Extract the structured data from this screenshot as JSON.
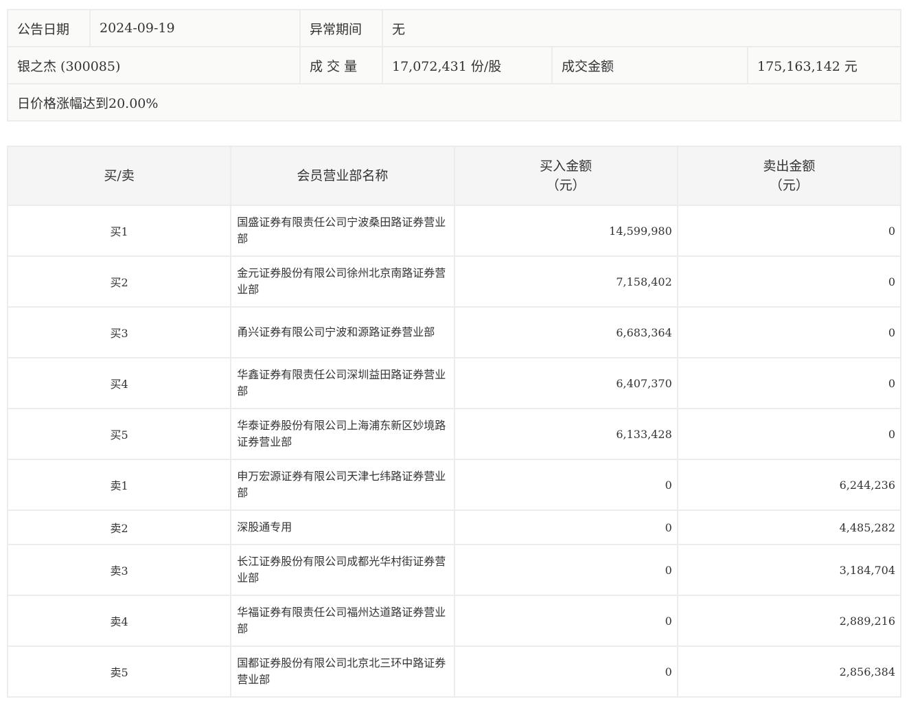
{
  "info": {
    "date_label": "公告日期",
    "date": "2024-09-19",
    "abnormal_label": "异常期间",
    "abnormal": "无",
    "stock": "银之杰 (300085)",
    "volume_label": "成 交 量",
    "volume": "17,072,431 份/股",
    "amount_label": "成交金额",
    "amount": "175,163,142 元",
    "reason": "日价格涨幅达到20.00%"
  },
  "table": {
    "headers": [
      "买/卖",
      "会员营业部名称",
      "买入金额",
      "卖出金额"
    ],
    "unit": "（元）",
    "rows": [
      {
        "side": "买1",
        "name": "国盛证券有限责任公司宁波桑田路证券营业部",
        "buy": "14,599,980",
        "sell": "0"
      },
      {
        "side": "买2",
        "name": "金元证券股份有限公司徐州北京南路证券营业部",
        "buy": "7,158,402",
        "sell": "0"
      },
      {
        "side": "买3",
        "name": "甬兴证券有限公司宁波和源路证券营业部",
        "buy": "6,683,364",
        "sell": "0"
      },
      {
        "side": "买4",
        "name": "华鑫证券有限责任公司深圳益田路证券营业部",
        "buy": "6,407,370",
        "sell": "0"
      },
      {
        "side": "买5",
        "name": "华泰证券股份有限公司上海浦东新区妙境路证券营业部",
        "buy": "6,133,428",
        "sell": "0"
      },
      {
        "side": "卖1",
        "name": "申万宏源证券有限公司天津七纬路证券营业部",
        "buy": "0",
        "sell": "6,244,236"
      },
      {
        "side": "卖2",
        "name": "深股通专用",
        "buy": "0",
        "sell": "4,485,282"
      },
      {
        "side": "卖3",
        "name": "长江证券股份有限公司成都光华村街证券营业部",
        "buy": "0",
        "sell": "3,184,704"
      },
      {
        "side": "卖4",
        "name": "华福证券有限责任公司福州达道路证券营业部",
        "buy": "0",
        "sell": "2,889,216"
      },
      {
        "side": "卖5",
        "name": "国都证券股份有限公司北京北三环中路证券营业部",
        "buy": "0",
        "sell": "2,856,384"
      }
    ]
  }
}
